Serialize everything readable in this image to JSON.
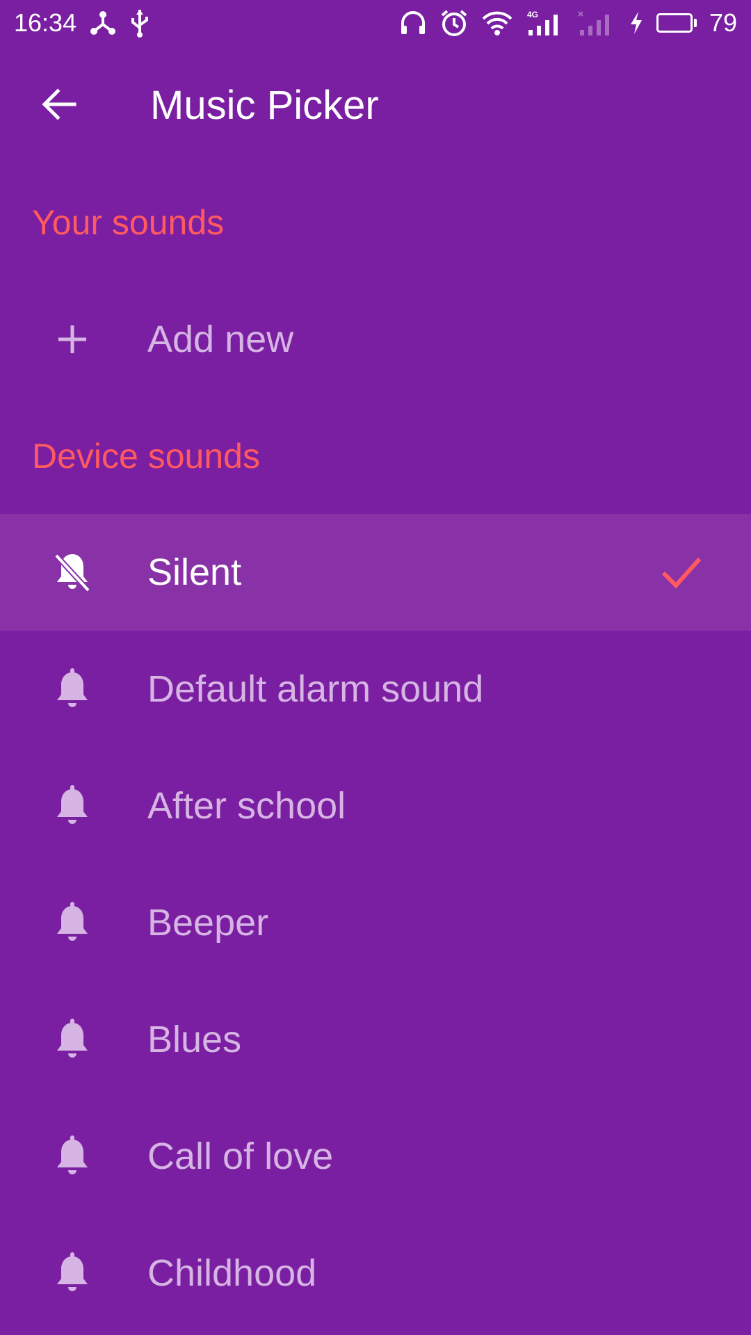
{
  "status_bar": {
    "time": "16:34",
    "battery_level": "79",
    "icons": [
      "share-icon",
      "usb-icon",
      "headphones-icon",
      "alarm-icon",
      "wifi-icon",
      "signal-4g-icon",
      "signal-no-sim-icon",
      "charging-icon",
      "battery-icon"
    ]
  },
  "app_bar": {
    "back_icon": "arrow-back-icon",
    "title": "Music Picker"
  },
  "sections": {
    "your_sounds": "Your sounds",
    "device_sounds": "Device sounds"
  },
  "your_sounds_items": [
    {
      "label": "Add new",
      "icon": "plus-icon"
    }
  ],
  "device_sounds_items": [
    {
      "label": "Silent",
      "icon": "bell-off-icon",
      "selected": true
    },
    {
      "label": "Default alarm sound",
      "icon": "bell-icon"
    },
    {
      "label": "After school",
      "icon": "bell-icon"
    },
    {
      "label": "Beeper",
      "icon": "bell-icon"
    },
    {
      "label": "Blues",
      "icon": "bell-icon"
    },
    {
      "label": "Call of love",
      "icon": "bell-icon"
    },
    {
      "label": "Childhood",
      "icon": "bell-icon"
    }
  ],
  "colors": {
    "background": "#7a1fa2",
    "selected_row": "#8932a8",
    "accent": "#ff5a5f",
    "secondary_text": "#d6b4e3",
    "battery_fill": "#24d024"
  }
}
